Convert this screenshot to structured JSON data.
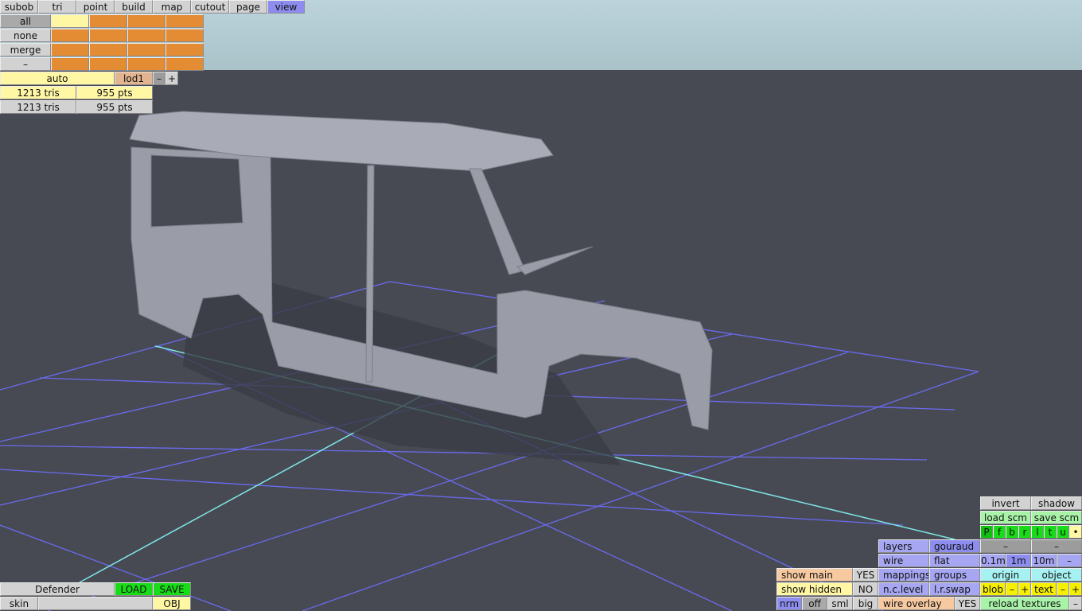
{
  "top_menu": [
    "subob",
    "tri",
    "point",
    "build",
    "map",
    "cutout",
    "page",
    "view"
  ],
  "select_panel": {
    "rows": [
      "all",
      "none",
      "merge",
      "–"
    ]
  },
  "lod": {
    "mode": "auto",
    "level": "lod1",
    "minus": "–",
    "plus": "+"
  },
  "stats": [
    {
      "tris": "1213 tris",
      "pts": "955 pts"
    },
    {
      "tris": "1213 tris",
      "pts": "955 pts"
    }
  ],
  "file": {
    "name": "Defender",
    "load": "LOAD",
    "save": "SAVE",
    "skin": "skin",
    "skin_value": "",
    "format": "OBJ"
  },
  "view_panel": {
    "invert": "invert",
    "shadow": "shadow",
    "load_scm": "load scm",
    "save_scm": "save scm",
    "views": [
      "P",
      "f",
      "b",
      "r",
      "l",
      "t",
      "u",
      "•"
    ],
    "layers": "layers",
    "gouraud": "gouraud",
    "dash": "–",
    "wire": "wire",
    "flat": "flat",
    "grid_sizes": [
      "0.1m",
      "1m",
      "10m"
    ],
    "show_main": "show main",
    "show_main_val": "YES",
    "mappings": "mappings",
    "groups": "groups",
    "origin": "origin",
    "object": "object",
    "show_hidden": "show hidden",
    "show_hidden_val": "NO",
    "nc_level": "n.c.level",
    "lr_swap": "l.r.swap",
    "blob": "blob",
    "text": "text",
    "minus": "–",
    "plus": "+",
    "nrm": "nrm",
    "off": "off",
    "sml": "sml",
    "big": "big",
    "wire_overlay": "wire overlay",
    "wire_overlay_val": "YES",
    "reload_textures": "reload textures"
  }
}
